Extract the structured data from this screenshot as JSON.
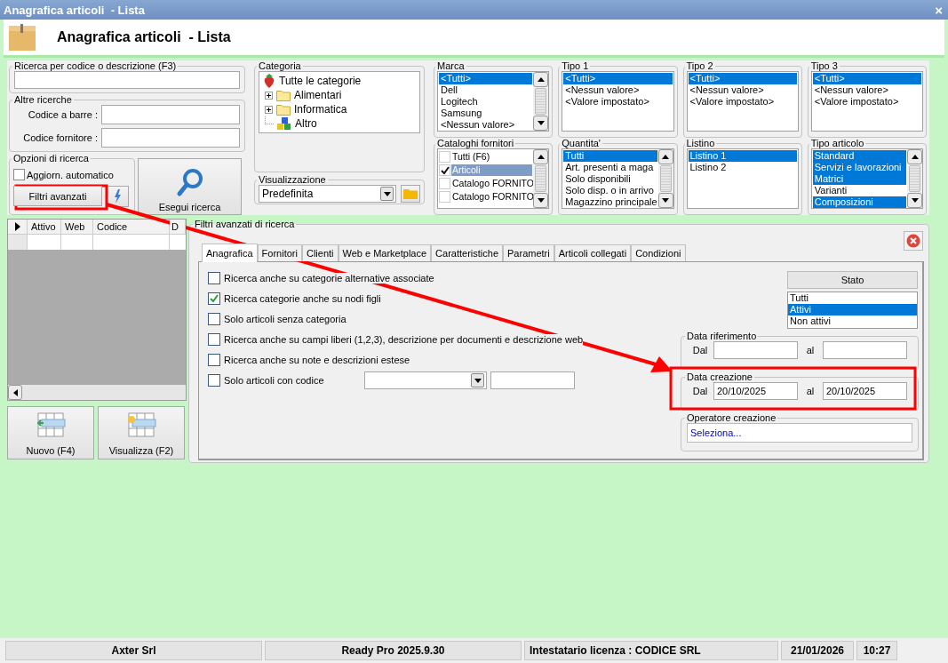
{
  "window": {
    "title": "Anagrafica articoli  - Lista",
    "close": "×"
  },
  "header": {
    "title": "Anagrafica articoli  - Lista"
  },
  "search_box": {
    "label": "Ricerca per codice o descrizione (F3)"
  },
  "other_searches": {
    "title": "Altre ricerche",
    "fields": [
      {
        "label": "Codice a barre :"
      },
      {
        "label": "Codice fornitore :"
      }
    ]
  },
  "options": {
    "title": "Opzioni di ricerca",
    "auto_update": {
      "label": "Aggiorn. automatico",
      "checked": false
    },
    "advanced_button": "Filtri avanzati"
  },
  "search_button": "Esegui ricerca",
  "category": {
    "title": "Categoria",
    "tree": [
      {
        "label": "Tutte le categorie",
        "kind": "root",
        "children": [
          {
            "label": "Alimentari",
            "kind": "folder",
            "expanded": false
          },
          {
            "label": "Informatica",
            "kind": "folder",
            "expanded": false
          },
          {
            "label": "Altro",
            "kind": "blocks"
          }
        ]
      }
    ]
  },
  "view": {
    "title": "Visualizzazione",
    "value": "Predefinita"
  },
  "lists": [
    {
      "title": "Marca",
      "kind": "list",
      "scrollbar": true,
      "items": [
        {
          "label": "<Tutti>",
          "selected": true
        },
        {
          "label": "Dell",
          "selected": false
        },
        {
          "label": "Logitech",
          "selected": false
        },
        {
          "label": "Samsung",
          "selected": false
        },
        {
          "label": "<Nessun valore>",
          "selected": false
        }
      ]
    },
    {
      "title": "Tipo 1",
      "kind": "list",
      "scrollbar": false,
      "items": [
        {
          "label": "<Tutti>",
          "selected": true
        },
        {
          "label": "<Nessun valore>",
          "selected": false
        },
        {
          "label": "<Valore impostato>",
          "selected": false
        }
      ]
    },
    {
      "title": "Tipo 2",
      "kind": "list",
      "scrollbar": false,
      "items": [
        {
          "label": "<Tutti>",
          "selected": true
        },
        {
          "label": "<Nessun valore>",
          "selected": false
        },
        {
          "label": "<Valore impostato>",
          "selected": false
        }
      ]
    },
    {
      "title": "Tipo 3",
      "kind": "list",
      "scrollbar": false,
      "items": [
        {
          "label": "<Tutti>",
          "selected": true
        },
        {
          "label": "<Nessun valore>",
          "selected": false
        },
        {
          "label": "<Valore impostato>",
          "selected": false
        }
      ]
    },
    {
      "title": "Cataloghi fornitori",
      "kind": "checklist",
      "scrollbar": true,
      "items": [
        {
          "label": "Tutti (F6)",
          "selected": false,
          "checked": false
        },
        {
          "label": "Articoli",
          "selected": true,
          "checked": true
        },
        {
          "label": "Catalogo FORNITO",
          "selected": false,
          "checked": false
        },
        {
          "label": "Catalogo FORNITO",
          "selected": false,
          "checked": false
        }
      ]
    },
    {
      "title": "Quantita'",
      "kind": "list",
      "scrollbar": true,
      "items": [
        {
          "label": "Tutti",
          "selected": true
        },
        {
          "label": "Art. presenti a maga",
          "selected": false
        },
        {
          "label": "Solo disponibili",
          "selected": false
        },
        {
          "label": "Solo disp. o in arrivo",
          "selected": false
        },
        {
          "label": "Magazzino principale",
          "selected": false
        }
      ]
    },
    {
      "title": "Listino",
      "kind": "list",
      "scrollbar": false,
      "items": [
        {
          "label": "Listino 1",
          "selected": true
        },
        {
          "label": "Listino 2",
          "selected": false
        }
      ]
    },
    {
      "title": "Tipo articolo",
      "kind": "list",
      "scrollbar": true,
      "items": [
        {
          "label": "Standard",
          "selected": true
        },
        {
          "label": "Servizi e lavorazioni",
          "selected": true
        },
        {
          "label": "Matrici",
          "selected": true
        },
        {
          "label": "Varianti",
          "selected": false
        },
        {
          "label": "Composizioni",
          "selected": true
        }
      ]
    }
  ],
  "grid": {
    "columns": [
      "Attivo",
      "Web",
      "Codice",
      "D"
    ]
  },
  "grid_buttons": [
    {
      "label": "Nuovo (F4)",
      "kind": "new"
    },
    {
      "label": "Visualizza (F2)",
      "kind": "view"
    }
  ],
  "advanced": {
    "title": "Filtri avanzati di ricerca",
    "tabs": [
      {
        "label": "Anagrafica",
        "selected": true
      },
      {
        "label": "Fornitori",
        "selected": false
      },
      {
        "label": "Clienti",
        "selected": false
      },
      {
        "label": "Web e Marketplace",
        "selected": false
      },
      {
        "label": "Caratteristiche",
        "selected": false
      },
      {
        "label": "Parametri",
        "selected": false
      },
      {
        "label": "Articoli collegati",
        "selected": false
      },
      {
        "label": "Condizioni",
        "selected": false
      }
    ],
    "checks": [
      {
        "label": "Ricerca anche su categorie alternative associate",
        "checked": false,
        "kind": "plain"
      },
      {
        "label": "Ricerca categorie anche su nodi figli",
        "checked": true,
        "kind": "plain"
      },
      {
        "label": "Solo articoli senza categoria",
        "checked": false,
        "kind": "plain"
      },
      {
        "label": "Ricerca anche su campi liberi (1,2,3), descrizione per documenti e descrizione web",
        "checked": false,
        "kind": "plain"
      },
      {
        "label": "Ricerca anche su note e descrizioni estese",
        "checked": false,
        "kind": "plain"
      },
      {
        "label": "Solo articoli con codice",
        "checked": false,
        "kind": "code"
      }
    ],
    "state": {
      "header": "Stato",
      "items": [
        {
          "label": "Tutti",
          "selected": false
        },
        {
          "label": "Attivi",
          "selected": true
        },
        {
          "label": "Non attivi",
          "selected": false
        }
      ]
    },
    "reference_date": {
      "title": "Data riferimento",
      "from_label": "Dal",
      "to_label": "al"
    },
    "creation_date": {
      "title": "Data creazione",
      "from_label": "Dal",
      "from": "20/10/2025",
      "to_label": "al",
      "to": "20/10/2025"
    },
    "creation_operator": {
      "title": "Operatore creazione",
      "value": "Seleziona..."
    }
  },
  "status_bar": [
    "Axter Srl",
    "Ready Pro 2025.9.30",
    "Intestatario licenza : CODICE SRL",
    "21/01/2026",
    "10:27"
  ]
}
